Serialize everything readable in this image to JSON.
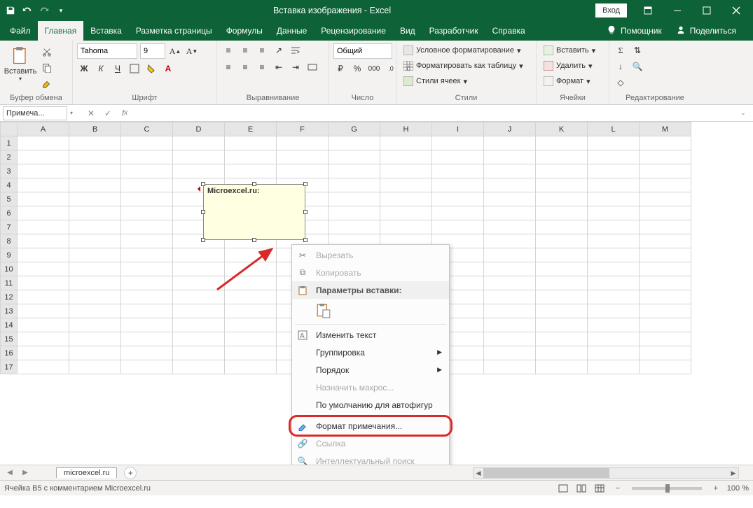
{
  "title": "Вставка изображения  -  Excel",
  "login": "Вход",
  "ribbonTabs": [
    "Файл",
    "Главная",
    "Вставка",
    "Разметка страницы",
    "Формулы",
    "Данные",
    "Рецензирование",
    "Вид",
    "Разработчик",
    "Справка"
  ],
  "activeTab": 1,
  "tellMe": "Помощник",
  "share": "Поделиться",
  "groups": {
    "clipboard": {
      "label": "Буфер обмена",
      "paste": "Вставить"
    },
    "font": {
      "label": "Шрифт",
      "name": "Tahoma",
      "size": "9",
      "bold": "Ж",
      "italic": "К",
      "underline": "Ч"
    },
    "alignment": {
      "label": "Выравнивание"
    },
    "number": {
      "label": "Число",
      "format": "Общий"
    },
    "styles": {
      "label": "Стили",
      "cond": "Условное форматирование",
      "table": "Форматировать как таблицу",
      "cell": "Стили ячеек"
    },
    "cells": {
      "label": "Ячейки",
      "insert": "Вставить",
      "delete": "Удалить",
      "format": "Формат"
    },
    "editing": {
      "label": "Редактирование"
    }
  },
  "nameBox": "Примеча...",
  "formula": "",
  "columns": [
    "",
    "A",
    "B",
    "C",
    "D",
    "E",
    "F",
    "G",
    "H",
    "I",
    "J",
    "K",
    "L",
    "M"
  ],
  "rowCount": 17,
  "comment": {
    "text": "Microexcel.ru:"
  },
  "context": {
    "cut": "Вырезать",
    "copy": "Копировать",
    "pasteHeader": "Параметры вставки:",
    "editText": "Изменить текст",
    "group": "Группировка",
    "order": "Порядок",
    "assignMacro": "Назначить макрос...",
    "setDefault": "По умолчанию для автофигур",
    "formatComment": "Формат примечания...",
    "link": "Ссылка",
    "smartLookup": "Интеллектуальный поиск"
  },
  "sheetTab": "microexcel.ru",
  "status": "Ячейка B5 с комментарием Microexcel.ru",
  "zoom": "100 %"
}
